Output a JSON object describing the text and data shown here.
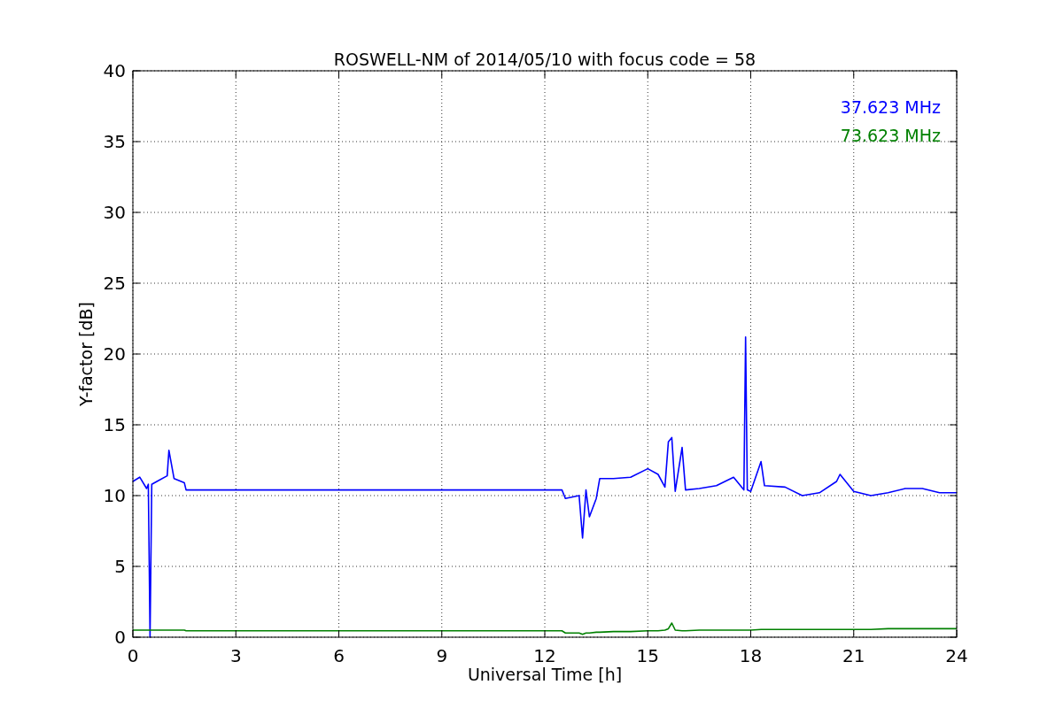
{
  "chart": {
    "chart_data": {
      "type": "line",
      "title": "ROSWELL-NM of 2014/05/10 with focus code = 58",
      "xlabel": "Universal Time [h]",
      "ylabel": "Y-factor [dB]",
      "x": [
        0,
        0.2,
        0.4,
        0.45,
        0.5,
        0.55,
        0.7,
        1.0,
        1.05,
        1.2,
        1.5,
        1.55,
        12.5,
        12.6,
        13.0,
        13.1,
        13.2,
        13.3,
        13.5,
        13.6,
        14.0,
        14.5,
        15.0,
        15.3,
        15.5,
        15.6,
        15.7,
        15.8,
        16.0,
        16.1,
        16.5,
        17.0,
        17.5,
        17.8,
        17.85,
        17.9,
        18.0,
        18.3,
        18.4,
        19.0,
        19.5,
        20.0,
        20.5,
        20.6,
        21.0,
        21.5,
        22.0,
        22.5,
        23.0,
        23.5,
        24.0
      ],
      "series": [
        {
          "name": "37.623 MHz",
          "color": "#0000ff",
          "values": [
            11.0,
            11.3,
            10.5,
            10.8,
            0.0,
            10.8,
            11.0,
            11.4,
            13.2,
            11.2,
            10.9,
            10.4,
            10.4,
            9.8,
            10.0,
            7.0,
            10.4,
            8.5,
            9.8,
            11.2,
            11.2,
            11.3,
            11.9,
            11.5,
            10.6,
            13.8,
            14.1,
            10.3,
            13.4,
            10.4,
            10.5,
            10.7,
            11.3,
            10.4,
            21.2,
            10.4,
            10.3,
            12.4,
            10.7,
            10.6,
            10.0,
            10.2,
            11.0,
            11.5,
            10.3,
            10.0,
            10.2,
            10.5,
            10.5,
            10.2,
            10.2
          ]
        },
        {
          "name": "73.623 MHz",
          "color": "#008000",
          "values": [
            0.5,
            0.5,
            0.5,
            0.5,
            0.5,
            0.5,
            0.5,
            0.5,
            0.5,
            0.5,
            0.5,
            0.45,
            0.45,
            0.3,
            0.3,
            0.2,
            0.3,
            0.3,
            0.35,
            0.35,
            0.4,
            0.4,
            0.45,
            0.45,
            0.5,
            0.6,
            1.0,
            0.5,
            0.45,
            0.45,
            0.5,
            0.5,
            0.5,
            0.5,
            0.5,
            0.5,
            0.5,
            0.55,
            0.55,
            0.55,
            0.55,
            0.55,
            0.55,
            0.55,
            0.55,
            0.55,
            0.6,
            0.6,
            0.6,
            0.6,
            0.6
          ]
        }
      ],
      "grid": true,
      "xlim": [
        0,
        24
      ],
      "ylim": [
        0,
        40
      ],
      "xticks": [
        0,
        3,
        6,
        9,
        12,
        15,
        18,
        21,
        24
      ],
      "yticks": [
        0,
        5,
        10,
        15,
        20,
        25,
        30,
        35,
        40
      ]
    }
  }
}
